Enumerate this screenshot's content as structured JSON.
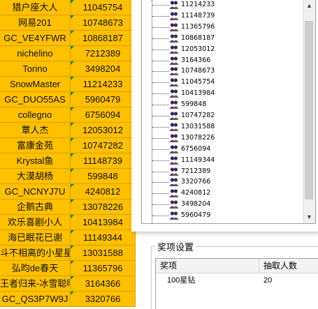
{
  "sheet": {
    "rows": [
      {
        "name": "猎户座大人",
        "value": "11045754"
      },
      {
        "name": "网易201",
        "value": "10748673"
      },
      {
        "name": "GC_VE4YFWR",
        "value": "10868187"
      },
      {
        "name": "nichelino",
        "value": "7212389"
      },
      {
        "name": "Torino",
        "value": "3498204"
      },
      {
        "name": "SnowMaster",
        "value": "11214233"
      },
      {
        "name": "GC_DUO55AS",
        "value": "5960479"
      },
      {
        "name": "collegno",
        "value": "6756094"
      },
      {
        "name": "覃人杰",
        "value": "12053012"
      },
      {
        "name": "富康金苑",
        "value": "10747282"
      },
      {
        "name": "Krystal鱼",
        "value": "11148739"
      },
      {
        "name": "大漠胡杨",
        "value": "599848"
      },
      {
        "name": "GC_NCNYJ7U",
        "value": "4240812"
      },
      {
        "name": "企鹅古典",
        "value": "13078226"
      },
      {
        "name": "欢乐喜剧小人",
        "value": "10413984"
      },
      {
        "name": "海已眠花已谢",
        "value": "11149344"
      },
      {
        "name": "斗不相离的小星星",
        "value": "13031588"
      },
      {
        "name": "弘昀de春天",
        "value": "11365796"
      },
      {
        "name": "王者归来-冰雪聪明",
        "value": "3164366"
      },
      {
        "name": "GC_QS3P7W9J",
        "value": "3320766"
      }
    ]
  },
  "tree": {
    "items": [
      "11214233",
      "11148739",
      "11365796",
      "10868187",
      "12053012",
      "3164366",
      "10748673",
      "11045754",
      "10413984",
      "599848",
      "10747282",
      "13031588",
      "13078226",
      "6756094",
      "11149344",
      "7212389",
      "3320766",
      "4240812",
      "3498204",
      "5960479"
    ],
    "icon": "user-group-icon"
  },
  "prize": {
    "group_title": "奖项设置",
    "columns": [
      "奖项",
      "抽取人数"
    ],
    "rows": [
      {
        "item": "100星钻",
        "count": "20"
      }
    ]
  },
  "colors": {
    "cell_fill": "#ffc000",
    "comment_marker": "#1e8a3a"
  }
}
